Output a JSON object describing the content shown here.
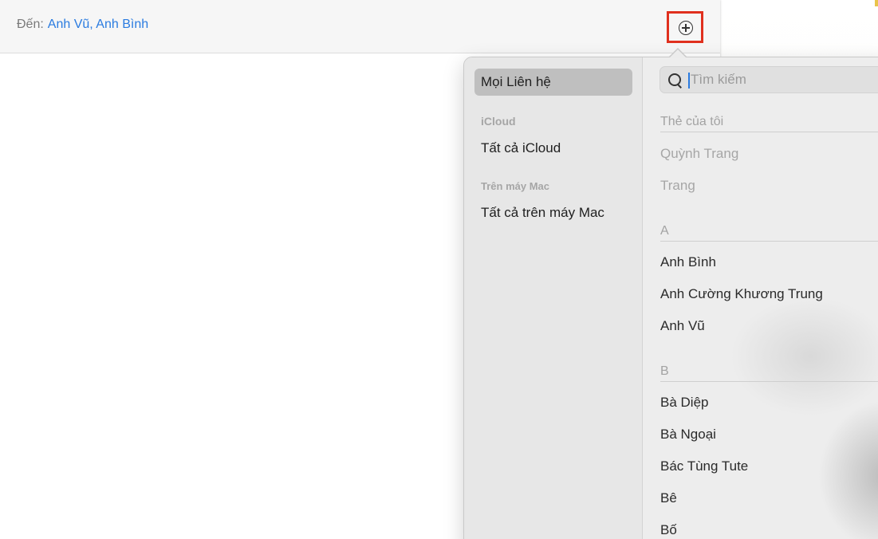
{
  "compose": {
    "to_label": "Đến:",
    "to_value": "Anh Vũ, Anh Bình"
  },
  "add_contact_icon": "plus-circle-icon",
  "colors": {
    "accent": "#2a7be0",
    "highlight_box": "#e0301e",
    "selected_row": "#bfbfbf"
  },
  "contacts_popover": {
    "sidebar": {
      "selected": "Mọi Liên hệ",
      "groups": [
        {
          "header": "iCloud",
          "items": [
            "Tất cả iCloud"
          ]
        },
        {
          "header": "Trên máy Mac",
          "items": [
            "Tất cả trên máy Mac"
          ]
        }
      ]
    },
    "search": {
      "placeholder": "Tìm kiếm",
      "value": ""
    },
    "my_card": {
      "title": "Thẻ của tôi",
      "items": [
        "Quỳnh Trang",
        "Trang"
      ]
    },
    "sections": [
      {
        "letter": "A",
        "contacts": [
          "Anh Bình",
          "Anh Cường Khương Trung",
          "Anh Vũ"
        ]
      },
      {
        "letter": "B",
        "contacts": [
          "Bà Diệp",
          "Bà Ngoại",
          "Bác Tùng Tute",
          "Bê",
          "Bố"
        ]
      }
    ]
  }
}
